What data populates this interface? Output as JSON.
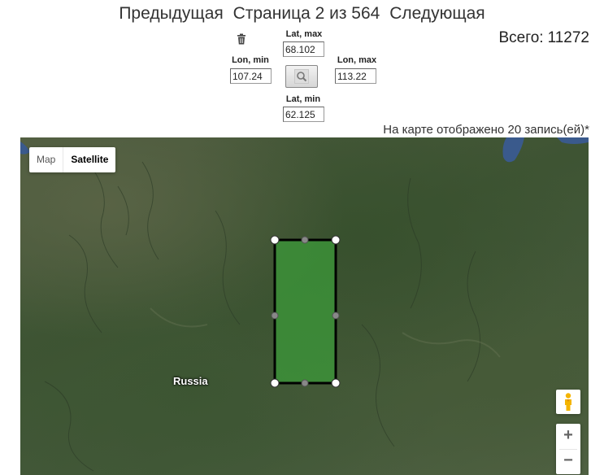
{
  "pager": {
    "prev_label": "Предыдущая",
    "page_text": "Страница 2 из 564",
    "next_label": "Следующая"
  },
  "total": {
    "label": "Всего:",
    "value": "11272"
  },
  "bbox_form": {
    "lat_max_label": "Lat, max",
    "lat_max_value": "68.102",
    "lon_min_label": "Lon, min",
    "lon_min_value": "107.24",
    "lon_max_label": "Lon, max",
    "lon_max_value": "113.22",
    "lat_min_label": "Lat, min",
    "lat_min_value": "62.125",
    "clear_icon": "trash-icon",
    "search_icon": "magnifier-icon"
  },
  "records_shown": "На карте отображено 20 запись(ей)*",
  "map": {
    "type_map_label": "Map",
    "type_satellite_label": "Satellite",
    "selected_type": "Satellite",
    "place_label": "Russia",
    "zoom_in_label": "+",
    "zoom_out_label": "−",
    "rectangle_fill": "#3c9a3a",
    "rectangle_stroke": "#000000",
    "water_color": "#3a5a8c"
  }
}
